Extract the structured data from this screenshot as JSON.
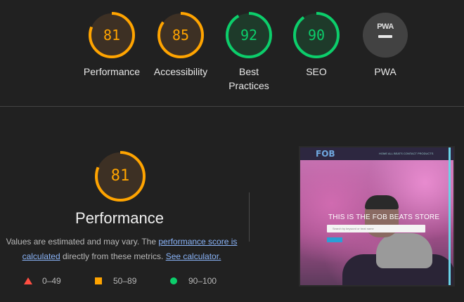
{
  "categories": [
    {
      "label": "Performance",
      "score": "81",
      "value": 81,
      "color": "#ffa400",
      "bg": "#3d3024"
    },
    {
      "label": "Accessibility",
      "score": "85",
      "value": 85,
      "color": "#ffa400",
      "bg": "#3d3024"
    },
    {
      "label": "Best Practices",
      "score": "92",
      "value": 92,
      "color": "#0cce6b",
      "bg": "#1e3a2a"
    },
    {
      "label": "SEO",
      "score": "90",
      "value": 90,
      "color": "#0cce6b",
      "bg": "#1e3a2a"
    },
    {
      "label": "PWA",
      "badge_text": "PWA",
      "icon": "pwa-badge-icon"
    }
  ],
  "performance": {
    "score": "81",
    "value": 81,
    "title": "Performance",
    "description_prefix": "Values are estimated and may vary. The ",
    "link_text": "performance score is calculated",
    "description_middle": " directly from these metrics. ",
    "calculator_link": "See calculator."
  },
  "legend": [
    {
      "icon": "triangle-icon",
      "range": "0–49",
      "color": "#ff4e42"
    },
    {
      "icon": "square-icon",
      "range": "50–89",
      "color": "#ffa400"
    },
    {
      "icon": "circle-icon",
      "range": "90–100",
      "color": "#0cce6b"
    }
  ],
  "screenshot": {
    "logo": "FOB",
    "nav_links": "HOME   ALL BEATS   CONTACT   PRODUCTS",
    "headline": "THIS IS THE FOB BEATS STORE",
    "search_placeholder": "Search by keyword or beat name"
  }
}
